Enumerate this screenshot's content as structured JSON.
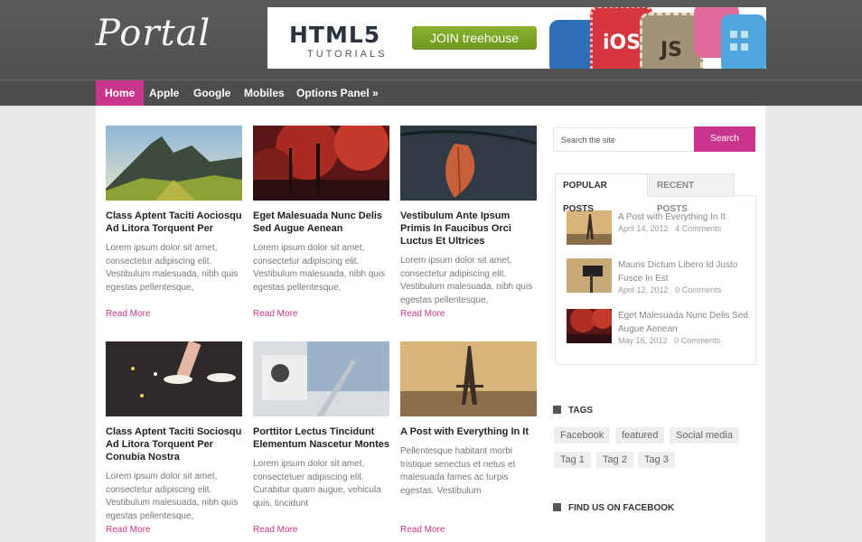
{
  "header": {
    "logo": "Portal",
    "banner": {
      "title": "HTML5",
      "subtitle": "TUTORIALS",
      "button": "JOIN treehouse",
      "badges": [
        "iOS",
        "JS"
      ]
    }
  },
  "nav": {
    "items": [
      "Home",
      "Apple",
      "Google",
      "Mobiles",
      "Options Panel »"
    ],
    "active_index": 0
  },
  "posts": [
    {
      "title": "Class Aptent Taciti Aociosqu Ad Litora Torquent Per",
      "excerpt": "Lorem ipsum dolor sit amet, consectetur adipiscing elit. Vestibulum malesuada, nibh quis egestas pellentesque,",
      "read_more": "Read More",
      "image": "mountains"
    },
    {
      "title": "Eget Malesuada Nunc Delis Sed Augue Aenean",
      "excerpt": "Lorem ipsum dolor sit amet, consectetur adipiscing elit. Vestibulum malesuada, nibh quis egestas pellentesque,",
      "read_more": "Read More",
      "image": "red-forest"
    },
    {
      "title": "Vestibulum Ante Ipsum Primis In Faucibus Orci Luctus Et Ultrices",
      "excerpt": "Lorem ipsum dolor sit amet, consectetur adipiscing elit. Vestibulum malesuada, nibh quis egestas pellentesque,",
      "read_more": "Read More",
      "image": "leaf"
    },
    {
      "title": "Class Aptent Taciti Sociosqu Ad Litora Torquent Per Conubia Nostra",
      "excerpt": "Lorem ipsum dolor sit amet, consectetur adipiscing elit. Vestibulum malesuada, nibh quis egestas pellentesque,",
      "read_more": "Read More",
      "image": "feet"
    },
    {
      "title": "Porttitor Lectus Tincidunt Elementum Nascetur Montes",
      "excerpt": "Lorem ipsum dolor sit amet, consectetuer adipiscing elit. Curabitur quam augue, vehicula quis, tincidunt",
      "read_more": "Read More",
      "image": "laptop"
    },
    {
      "title": "A Post with Everything In It",
      "excerpt": "Pellentesque habitant morbi tristique senectus et netus et malesuada fames ac turpis egestas. Vestibulum",
      "read_more": "Read More",
      "image": "eiffel"
    }
  ],
  "sidebar": {
    "search": {
      "placeholder": "Search the site",
      "button": "Search"
    },
    "tabs": [
      "POPULAR POSTS",
      "RECENT POSTS"
    ],
    "popular": [
      {
        "title": "A Post with Everything In It",
        "date": "April 14, 2012",
        "comments": "4 Comments"
      },
      {
        "title": "Mauris Dictum Libero Id Justo Fusce In Est",
        "date": "April 12, 2012",
        "comments": "0 Comments"
      },
      {
        "title": "Eget Malesuada Nunc Delis Sed Augue Aenean",
        "date": "May 16, 2012",
        "comments": "0 Comments"
      }
    ],
    "tags_heading": "TAGS",
    "tags": [
      "Facebook",
      "featured",
      "Social media",
      "Tag 1",
      "Tag 2",
      "Tag 3"
    ],
    "facebook_heading": "FIND US ON FACEBOOK"
  },
  "colors": {
    "accent": "#c9358c",
    "header": "#555555",
    "nav": "#4d4d4d"
  }
}
